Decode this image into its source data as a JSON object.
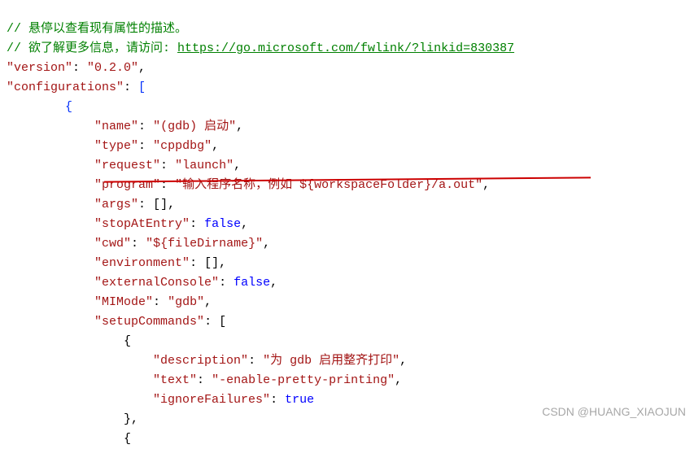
{
  "comment1": "// 悬停以查看现有属性的描述。",
  "comment2_prefix": "// 欲了解更多信息，请访问: ",
  "comment2_url": "https://go.microsoft.com/fwlink/?linkid=830387",
  "version_key": "\"version\"",
  "version_val": "\"0.2.0\"",
  "configurations_key": "\"configurations\"",
  "name_key": "\"name\"",
  "name_val": "\"(gdb) 启动\"",
  "type_key": "\"type\"",
  "type_val": "\"cppdbg\"",
  "request_key": "\"request\"",
  "request_val": "\"launch\"",
  "program_key": "\"program\"",
  "program_val": "\"输入程序名称，例如 ${workspaceFolder}/a.out\"",
  "args_key": "\"args\"",
  "args_val": "[]",
  "stopAtEntry_key": "\"stopAtEntry\"",
  "stopAtEntry_val": "false",
  "cwd_key": "\"cwd\"",
  "cwd_val": "\"${fileDirname}\"",
  "environment_key": "\"environment\"",
  "environment_val": "[]",
  "externalConsole_key": "\"externalConsole\"",
  "externalConsole_val": "false",
  "mimode_key": "\"MIMode\"",
  "mimode_val": "\"gdb\"",
  "setupCommands_key": "\"setupCommands\"",
  "description_key": "\"description\"",
  "description_val": "\"为 gdb 启用整齐打印\"",
  "text_key": "\"text\"",
  "text_val": "\"-enable-pretty-printing\"",
  "ignoreFailures_key": "\"ignoreFailures\"",
  "ignoreFailures_val": "true",
  "watermark": "CSDN @HUANG_XIAOJUN"
}
